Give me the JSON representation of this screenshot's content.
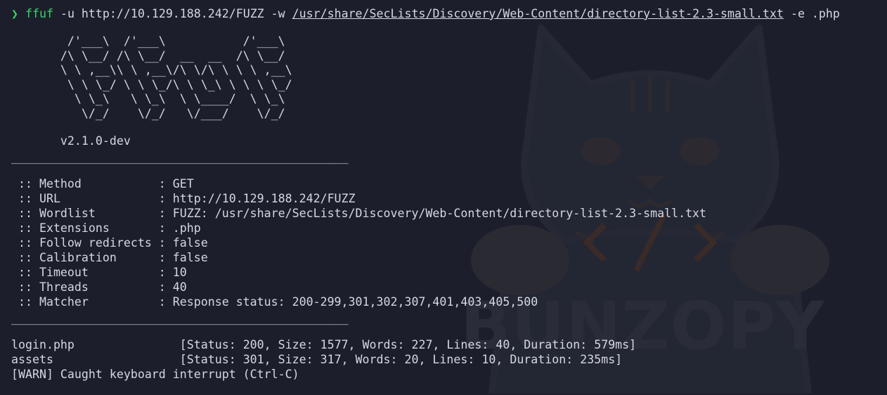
{
  "watermark": {
    "text": "BUNZOPY",
    "icon": "cat-mascot-icon"
  },
  "command": {
    "prompt_glyph": "❯",
    "program": "ffuf",
    "args_before": " -u http://10.129.188.242/FUZZ -w ",
    "wordlist_path": "/usr/share/SecLists/Discovery/Web-Content/directory-list-2.3-small.txt",
    "args_after": " -e .php"
  },
  "banner": {
    "ascii": [
      "        /'___\\  /'___\\           /'___\\",
      "       /\\ \\__/ /\\ \\__/  __  __  /\\ \\__/",
      "       \\ \\ ,__\\\\ \\ ,__\\/\\ \\/\\ \\ \\ \\ ,__\\",
      "        \\ \\ \\_/ \\ \\ \\_/\\ \\ \\_\\ \\ \\ \\ \\_/",
      "         \\ \\_\\   \\ \\_\\  \\ \\____/  \\ \\_\\",
      "          \\/_/    \\/_/   \\/___/    \\/_/"
    ],
    "version": "       v2.1.0-dev"
  },
  "rule": "________________________________________________",
  "config": [
    {
      "key": " :: Method           ",
      "value": ": GET"
    },
    {
      "key": " :: URL              ",
      "value": ": http://10.129.188.242/FUZZ"
    },
    {
      "key": " :: Wordlist         ",
      "value": ": FUZZ: /usr/share/SecLists/Discovery/Web-Content/directory-list-2.3-small.txt"
    },
    {
      "key": " :: Extensions       ",
      "value": ": .php"
    },
    {
      "key": " :: Follow redirects ",
      "value": ": false"
    },
    {
      "key": " :: Calibration      ",
      "value": ": false"
    },
    {
      "key": " :: Timeout          ",
      "value": ": 10"
    },
    {
      "key": " :: Threads          ",
      "value": ": 40"
    },
    {
      "key": " :: Matcher          ",
      "value": ": Response status: 200-299,301,302,307,401,403,405,500"
    }
  ],
  "results": [
    {
      "name": "login.php               ",
      "info": "[Status: 200, Size: 1577, Words: 227, Lines: 40, Duration: 579ms]"
    },
    {
      "name": "assets                  ",
      "info": "[Status: 301, Size: 317, Words: 20, Lines: 10, Duration: 235ms]"
    }
  ],
  "warning": "[WARN] Caught keyboard interrupt (Ctrl-C)"
}
